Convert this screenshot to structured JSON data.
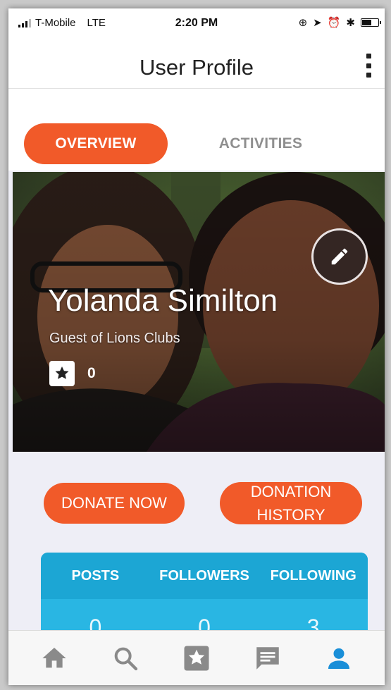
{
  "status_bar": {
    "carrier": "T-Mobile",
    "network": "LTE",
    "time": "2:20 PM"
  },
  "header": {
    "title": "User Profile",
    "menu_icon": "more-vertical-icon"
  },
  "tabs": [
    {
      "label": "OVERVIEW",
      "active": true
    },
    {
      "label": "ACTIVITIES",
      "active": false
    }
  ],
  "profile": {
    "name": "Yolanda Similton",
    "subtitle": "Guest of Lions Clubs",
    "badge_count": "0",
    "edit_icon": "pencil-icon",
    "badge_icon": "star-badge-icon"
  },
  "actions": {
    "donate_label": "DONATE NOW",
    "history_label": "DONATION HISTORY"
  },
  "stats": {
    "headers": [
      "POSTS",
      "FOLLOWERS",
      "FOLLOWING"
    ],
    "values": [
      "0",
      "0",
      "3"
    ]
  },
  "bottom_nav": [
    {
      "icon": "home-icon",
      "active": false
    },
    {
      "icon": "search-icon",
      "active": false
    },
    {
      "icon": "star-badge-icon",
      "active": false
    },
    {
      "icon": "chat-icon",
      "active": false
    },
    {
      "icon": "profile-icon",
      "active": true
    }
  ],
  "colors": {
    "accent": "#f15a29",
    "stats_header": "#1ca6d4",
    "stats_body": "#29b6e3",
    "nav_active": "#1a8fd8",
    "nav_inactive": "#8a8a8a"
  }
}
